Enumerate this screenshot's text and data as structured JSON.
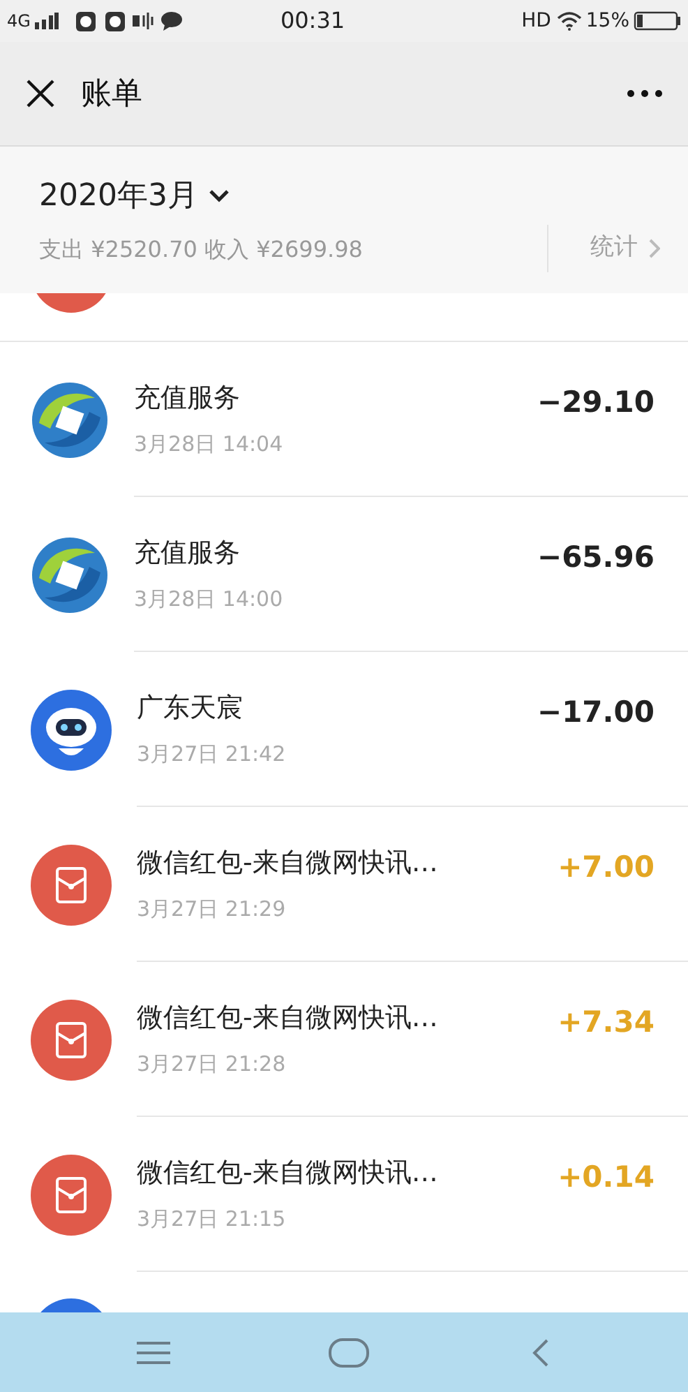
{
  "status_bar": {
    "network": "4G",
    "time": "00:31",
    "hd": "HD",
    "battery": "15%"
  },
  "header": {
    "title": "账单"
  },
  "summary": {
    "month": "2020年3月",
    "totals": "支出 ¥2520.70 收入 ¥2699.98",
    "stats_link": "统计"
  },
  "transactions": [
    {
      "kind": "recharge",
      "title": "充值服务",
      "time": "3月28日 14:04",
      "amount": "−29.10",
      "income": false
    },
    {
      "kind": "recharge",
      "title": "充值服务",
      "time": "3月28日 14:00",
      "amount": "−65.96",
      "income": false
    },
    {
      "kind": "robot",
      "title": "广东天宸",
      "time": "3月27日 21:42",
      "amount": "−17.00",
      "income": false
    },
    {
      "kind": "red-packet",
      "title": "微信红包-来自微网快讯…",
      "time": "3月27日 21:29",
      "amount": "+7.00",
      "income": true
    },
    {
      "kind": "red-packet",
      "title": "微信红包-来自微网快讯…",
      "time": "3月27日 21:28",
      "amount": "+7.34",
      "income": true
    },
    {
      "kind": "red-packet",
      "title": "微信红包-来自微网快讯…",
      "time": "3月27日 21:15",
      "amount": "+0.14",
      "income": true
    }
  ]
}
